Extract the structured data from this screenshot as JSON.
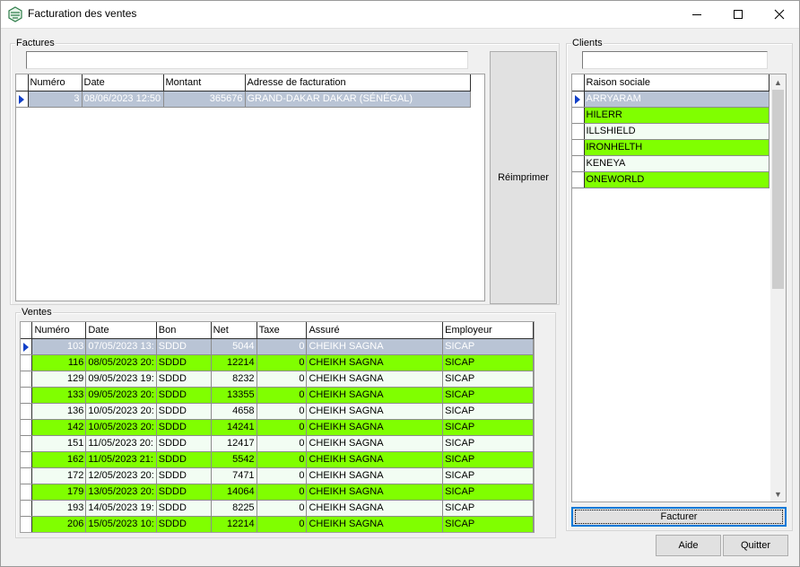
{
  "window": {
    "title": "Facturation des ventes",
    "controls": [
      "minimize",
      "maximize",
      "close"
    ]
  },
  "factures": {
    "group_label": "Factures",
    "filter_value": "",
    "columns": [
      "Numéro",
      "Date",
      "Montant",
      "Adresse de facturation"
    ],
    "rows": [
      {
        "numero": "3",
        "date": "08/06/2023 12:50",
        "montant": "365676",
        "adresse": "GRAND-DAKAR DAKAR (SÉNÉGAL)"
      }
    ],
    "reprint_label": "Réimprimer"
  },
  "ventes": {
    "group_label": "Ventes",
    "columns": [
      "Numéro",
      "Date",
      "Bon",
      "Net",
      "Taxe",
      "Assuré",
      "Employeur"
    ],
    "rows": [
      {
        "numero": "103",
        "date": "07/05/2023 13:",
        "bon": "SDDD",
        "net": "5044",
        "taxe": "0",
        "assure": "CHEIKH SAGNA",
        "employeur": "SICAP"
      },
      {
        "numero": "116",
        "date": "08/05/2023 20:",
        "bon": "SDDD",
        "net": "12214",
        "taxe": "0",
        "assure": "CHEIKH SAGNA",
        "employeur": "SICAP"
      },
      {
        "numero": "129",
        "date": "09/05/2023 19:",
        "bon": "SDDD",
        "net": "8232",
        "taxe": "0",
        "assure": "CHEIKH SAGNA",
        "employeur": "SICAP"
      },
      {
        "numero": "133",
        "date": "09/05/2023 20:",
        "bon": "SDDD",
        "net": "13355",
        "taxe": "0",
        "assure": "CHEIKH SAGNA",
        "employeur": "SICAP"
      },
      {
        "numero": "136",
        "date": "10/05/2023 20:",
        "bon": "SDDD",
        "net": "4658",
        "taxe": "0",
        "assure": "CHEIKH SAGNA",
        "employeur": "SICAP"
      },
      {
        "numero": "142",
        "date": "10/05/2023 20:",
        "bon": "SDDD",
        "net": "14241",
        "taxe": "0",
        "assure": "CHEIKH SAGNA",
        "employeur": "SICAP"
      },
      {
        "numero": "151",
        "date": "11/05/2023 20:",
        "bon": "SDDD",
        "net": "12417",
        "taxe": "0",
        "assure": "CHEIKH SAGNA",
        "employeur": "SICAP"
      },
      {
        "numero": "162",
        "date": "11/05/2023 21:",
        "bon": "SDDD",
        "net": "5542",
        "taxe": "0",
        "assure": "CHEIKH SAGNA",
        "employeur": "SICAP"
      },
      {
        "numero": "172",
        "date": "12/05/2023 20:",
        "bon": "SDDD",
        "net": "7471",
        "taxe": "0",
        "assure": "CHEIKH SAGNA",
        "employeur": "SICAP"
      },
      {
        "numero": "179",
        "date": "13/05/2023 20:",
        "bon": "SDDD",
        "net": "14064",
        "taxe": "0",
        "assure": "CHEIKH SAGNA",
        "employeur": "SICAP"
      },
      {
        "numero": "193",
        "date": "14/05/2023 19:",
        "bon": "SDDD",
        "net": "8225",
        "taxe": "0",
        "assure": "CHEIKH SAGNA",
        "employeur": "SICAP"
      },
      {
        "numero": "206",
        "date": "15/05/2023 10:",
        "bon": "SDDD",
        "net": "12214",
        "taxe": "0",
        "assure": "CHEIKH SAGNA",
        "employeur": "SICAP"
      }
    ]
  },
  "clients": {
    "group_label": "Clients",
    "filter_value": "",
    "columns": [
      "Raison sociale"
    ],
    "rows": [
      "ARRYARAM",
      "HILERR",
      "ILLSHIELD",
      "IRONHELTH",
      "KENEYA",
      "ONEWORLD"
    ],
    "invoice_label": "Facturer"
  },
  "footer": {
    "help_label": "Aide",
    "quit_label": "Quitter"
  },
  "colors": {
    "selected_row": "#b9c4d5",
    "highlight_row": "#80ff00",
    "plain_row": "#f2fdf3",
    "row_indicator": "#1240c8"
  }
}
